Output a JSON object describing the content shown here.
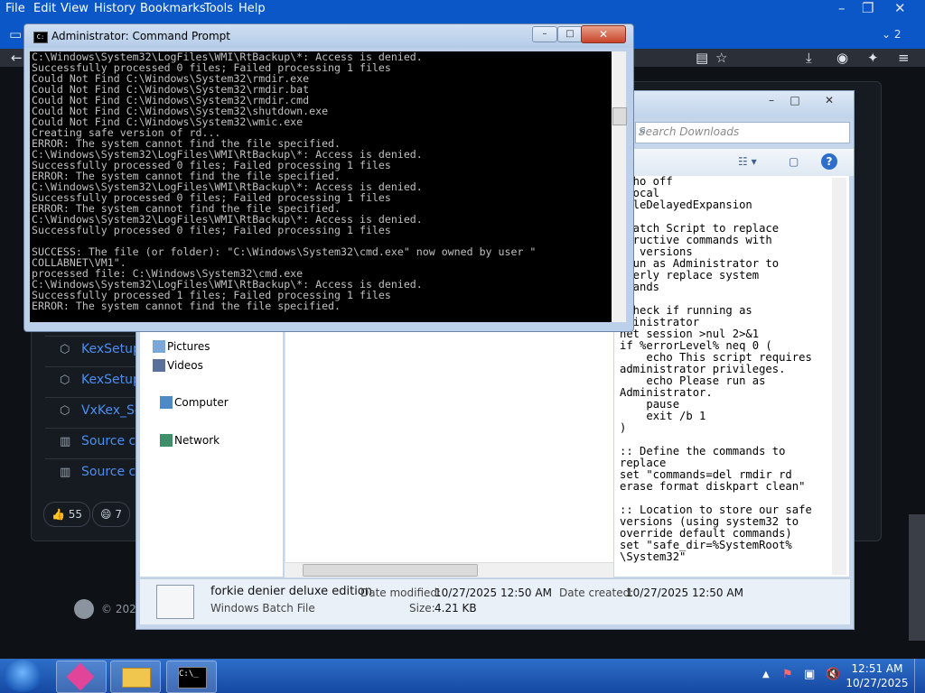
{
  "browser": {
    "menu": [
      "File",
      "Edit",
      "View",
      "History",
      "Bookmarks",
      "Tools",
      "Help"
    ],
    "tab_count": "2",
    "links": [
      "KexSetup",
      "KexSetup",
      "VxKex_Se",
      "Source co",
      "Source co"
    ],
    "reactions": [
      {
        "emoji": "👍",
        "count": "55"
      },
      {
        "emoji": "😄",
        "count": "7"
      }
    ],
    "footer_copy": "© 202"
  },
  "explorer": {
    "search_placeholder": "Search Downloads",
    "nav": {
      "pictures": "Pictures",
      "videos": "Videos",
      "computer": "Computer",
      "network": "Network"
    },
    "preview_text": "echo off\ntlocal\nableDelayedExpansion\n\n Batch Script to replace\nstructive commands with\nfe versions\n Run as Administrator to\noperly replace system\nmmands\n\n Check if running as\ndministrator\nnet session >nul 2>&1\nif %errorLevel% neq 0 (\n    echo This script requires\nadministrator privileges.\n    echo Please run as\nAdministrator.\n    pause\n    exit /b 1\n)\n\n:: Define the commands to\nreplace\nset \"commands=del rmdir rd\nerase format diskpart clean\"\n\n:: Location to store our safe\nversions (using system32 to\noverride default commands)\nset \"safe_dir=%SystemRoot%\n\\System32\"",
    "details": {
      "name": "forkie denier deluxe edition",
      "type": "Windows Batch File",
      "modified_label": "Date modified:",
      "modified_value": "10/27/2025 12:50 AM",
      "size_label": "Size:",
      "size_value": "4.21 KB",
      "created_label": "Date created:",
      "created_value": "10/27/2025 12:50 AM"
    }
  },
  "cmd": {
    "title": "Administrator: Command Prompt",
    "lines": [
      "C:\\Windows\\System32\\LogFiles\\WMI\\RtBackup\\*: Access is denied.",
      "Successfully processed 0 files; Failed processing 1 files",
      "Could Not Find C:\\Windows\\System32\\rmdir.exe",
      "Could Not Find C:\\Windows\\System32\\rmdir.bat",
      "Could Not Find C:\\Windows\\System32\\rmdir.cmd",
      "Could Not Find C:\\Windows\\System32\\shutdown.exe",
      "Could Not Find C:\\Windows\\System32\\wmic.exe",
      "Creating safe version of rd...",
      "ERROR: The system cannot find the file specified.",
      "C:\\Windows\\System32\\LogFiles\\WMI\\RtBackup\\*: Access is denied.",
      "Successfully processed 0 files; Failed processing 1 files",
      "ERROR: The system cannot find the file specified.",
      "C:\\Windows\\System32\\LogFiles\\WMI\\RtBackup\\*: Access is denied.",
      "Successfully processed 0 files; Failed processing 1 files",
      "ERROR: The system cannot find the file specified.",
      "C:\\Windows\\System32\\LogFiles\\WMI\\RtBackup\\*: Access is denied.",
      "Successfully processed 0 files; Failed processing 1 files",
      "",
      "SUCCESS: The file (or folder): \"C:\\Windows\\System32\\cmd.exe\" now owned by user \"",
      "COLLABNET\\VM1\".",
      "processed file: C:\\Windows\\System32\\cmd.exe",
      "C:\\Windows\\System32\\LogFiles\\WMI\\RtBackup\\*: Access is denied.",
      "Successfully processed 1 files; Failed processing 1 files",
      "ERROR: The system cannot find the file specified."
    ]
  },
  "taskbar": {
    "time": "12:51 AM",
    "date": "10/27/2025"
  }
}
